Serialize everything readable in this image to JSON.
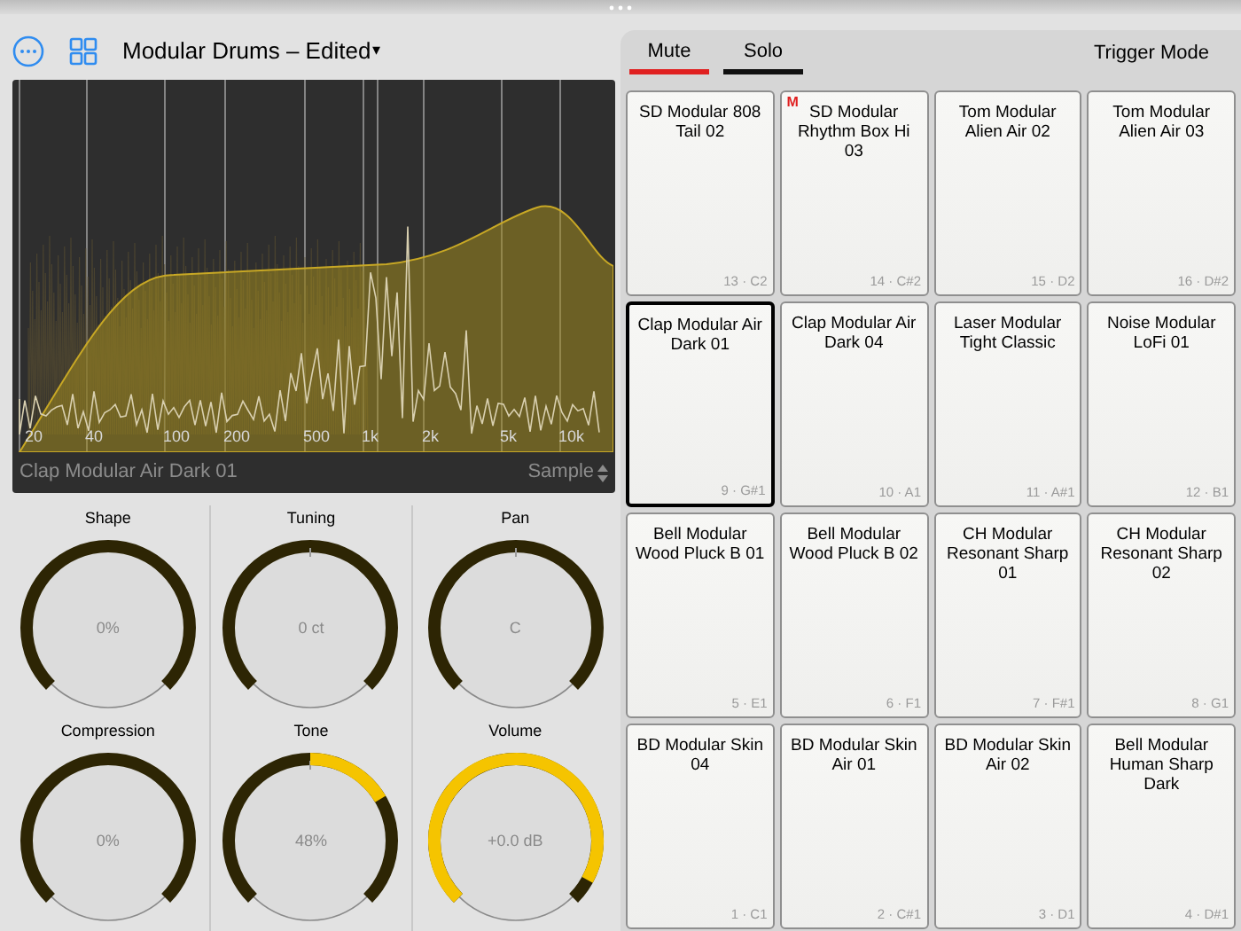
{
  "header": {
    "title": "Modular Drums – Edited",
    "caret": "▾"
  },
  "spectrum": {
    "freq_labels": [
      "20",
      "40",
      "100",
      "200",
      "500",
      "1k",
      "2k",
      "5k",
      "10k"
    ],
    "footer_left": "Clap Modular Air Dark 01",
    "footer_right": "Sample"
  },
  "knobs": [
    {
      "label": "Shape",
      "value": "0%",
      "kind": "unipolar"
    },
    {
      "label": "Tuning",
      "value": "0 ct",
      "kind": "bipolar"
    },
    {
      "label": "Pan",
      "value": "C",
      "kind": "bipolar"
    },
    {
      "label": "Compression",
      "value": "0%",
      "kind": "unipolar"
    },
    {
      "label": "Tone",
      "value": "48%",
      "level": 0.72,
      "kind": "bipolar"
    },
    {
      "label": "Volume",
      "value": "+0.0 dB",
      "level": 0.94,
      "kind": "unipolar"
    }
  ],
  "tabs": [
    {
      "label": "Mute",
      "color": "#e02020"
    },
    {
      "label": "Solo",
      "color": "#111111"
    }
  ],
  "trigger_mode": "Trigger Mode",
  "mute_mark": "M",
  "pads": [
    {
      "name": "SD Modular 808 Tail 02",
      "note": "13 · C2",
      "selected": false,
      "muted": false
    },
    {
      "name": "SD Modular Rhythm Box Hi 03",
      "note": "14 · C#2",
      "selected": false,
      "muted": true
    },
    {
      "name": "Tom Modular Alien Air 02",
      "note": "15 · D2",
      "selected": false,
      "muted": false
    },
    {
      "name": "Tom Modular Alien Air 03",
      "note": "16 · D#2",
      "selected": false,
      "muted": false
    },
    {
      "name": "Clap Modular Air Dark 01",
      "note": "9 · G#1",
      "selected": true,
      "muted": false
    },
    {
      "name": "Clap Modular Air Dark 04",
      "note": "10 · A1",
      "selected": false,
      "muted": false
    },
    {
      "name": "Laser Modular Tight Classic",
      "note": "11 · A#1",
      "selected": false,
      "muted": false
    },
    {
      "name": "Noise Modular LoFi 01",
      "note": "12 · B1",
      "selected": false,
      "muted": false
    },
    {
      "name": "Bell Modular Wood Pluck B 01",
      "note": "5 · E1",
      "selected": false,
      "muted": false
    },
    {
      "name": "Bell Modular Wood Pluck B 02",
      "note": "6 · F1",
      "selected": false,
      "muted": false
    },
    {
      "name": "CH Modular Resonant Sharp 01",
      "note": "7 · F#1",
      "selected": false,
      "muted": false
    },
    {
      "name": "CH Modular Resonant Sharp 02",
      "note": "8 · G1",
      "selected": false,
      "muted": false
    },
    {
      "name": "BD Modular Skin 04",
      "note": "1 · C1",
      "selected": false,
      "muted": false
    },
    {
      "name": "BD Modular Skin Air 01",
      "note": "2 · C#1",
      "selected": false,
      "muted": false
    },
    {
      "name": "BD Modular Skin Air 02",
      "note": "3 · D1",
      "selected": false,
      "muted": false
    },
    {
      "name": "Bell Modular Human Sharp Dark",
      "note": "4 · D#1",
      "selected": false,
      "muted": false
    }
  ]
}
